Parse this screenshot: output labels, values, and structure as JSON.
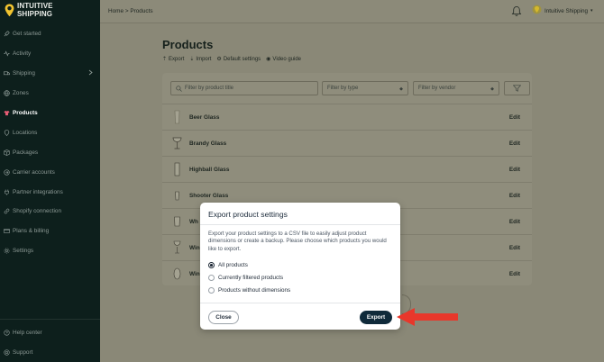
{
  "brand": {
    "line1": "INTUITIVE",
    "line2": "SHIPPING",
    "accent": "#f2c430"
  },
  "sidebar": {
    "items": [
      {
        "label": "Get started",
        "icon": "rocket-icon"
      },
      {
        "label": "Activity",
        "icon": "activity-icon"
      },
      {
        "label": "Shipping",
        "icon": "truck-icon"
      },
      {
        "label": "Zones",
        "icon": "globe-icon"
      },
      {
        "label": "Products",
        "icon": "shirt-icon",
        "active": true
      },
      {
        "label": "Locations",
        "icon": "location-icon"
      },
      {
        "label": "Packages",
        "icon": "package-icon"
      },
      {
        "label": "Carrier accounts",
        "icon": "carrier-icon"
      },
      {
        "label": "Partner integrations",
        "icon": "plug-icon"
      },
      {
        "label": "Shopify connection",
        "icon": "link-icon"
      },
      {
        "label": "Plans & billing",
        "icon": "card-icon"
      },
      {
        "label": "Settings",
        "icon": "gear-icon"
      }
    ],
    "footer": [
      {
        "label": "Help center",
        "icon": "help-icon"
      },
      {
        "label": "Support",
        "icon": "support-icon"
      }
    ]
  },
  "header": {
    "breadcrumb": "Home > Products",
    "user_name": "Intuitive Shipping"
  },
  "page": {
    "title": "Products",
    "actions": [
      "Export",
      "Import",
      "Default settings",
      "Video guide"
    ],
    "search_placeholder": "Filter by product title",
    "filter_type": "Filter by type",
    "filter_vendor": "Filter by vendor"
  },
  "products": [
    {
      "name": "Beer Glass",
      "edit": "Edit"
    },
    {
      "name": "Brandy Glass",
      "edit": "Edit"
    },
    {
      "name": "Highball Glass",
      "edit": "Edit"
    },
    {
      "name": "Shooter Glass",
      "edit": "Edit"
    },
    {
      "name": "Wh",
      "edit": "Edit"
    },
    {
      "name": "Win",
      "edit": "Edit"
    },
    {
      "name": "Win",
      "edit": "Edit"
    }
  ],
  "modal": {
    "title": "Export product settings",
    "description": "Export your product settings to a CSV file to easily adjust product dimensions or create a backup. Please choose which products you would like to export.",
    "options": [
      {
        "label": "All products",
        "checked": true
      },
      {
        "label": "Currently filtered products",
        "checked": false
      },
      {
        "label": "Products without dimensions",
        "checked": false
      }
    ],
    "close_label": "Close",
    "export_label": "Export"
  },
  "colors": {
    "annotation_arrow": "#e8372b",
    "export_button": "#0f2a3a",
    "sidebar_bg": "#0d1f1c"
  }
}
